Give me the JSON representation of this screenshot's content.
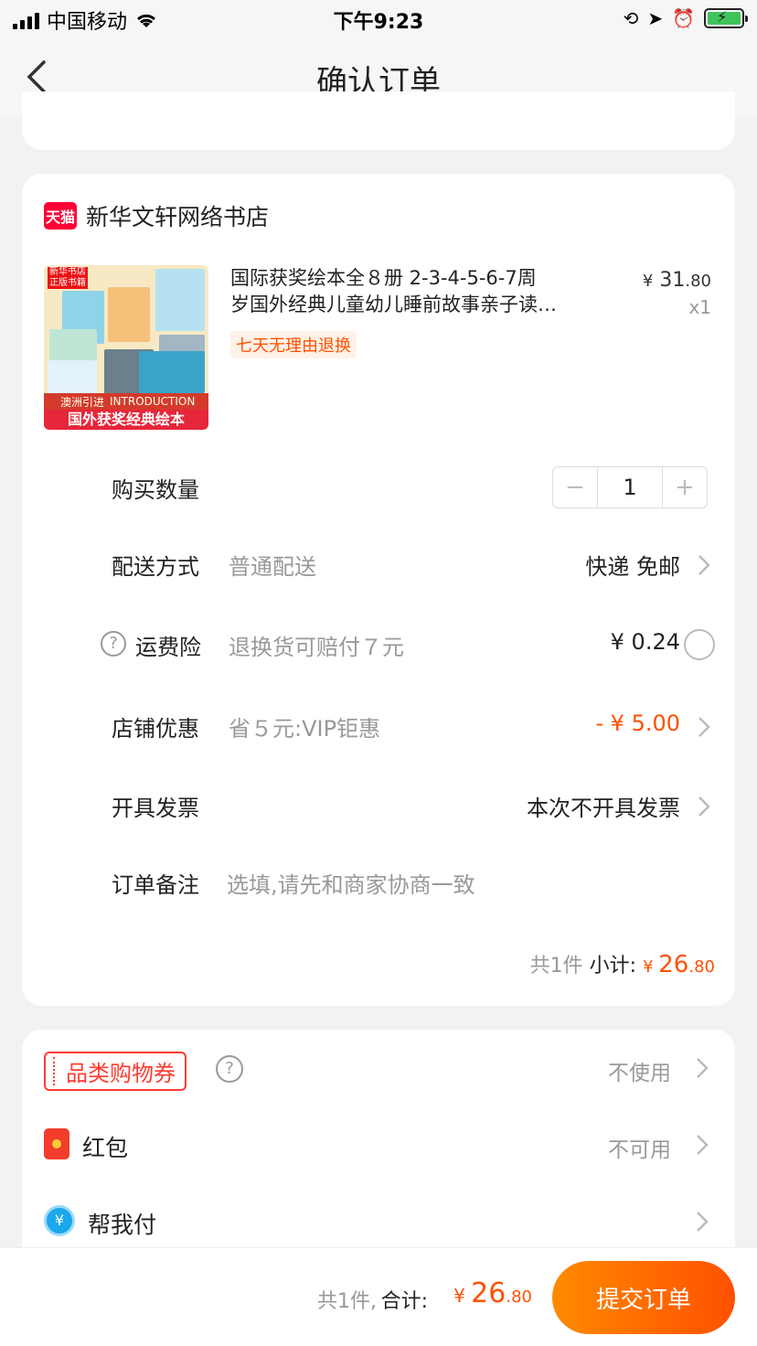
{
  "status_bar": {
    "carrier": "中国移动",
    "time": "下午9:23"
  },
  "nav": {
    "title": "确认订单"
  },
  "shop": {
    "badge": "天猫",
    "name": "新华文轩网络书店"
  },
  "product": {
    "title_line1": "国际获奖绘本全８册 2-3-4-5-6-7周",
    "title_line2": "岁国外经典儿童幼儿睡前故事亲子读…",
    "price_yen": "¥",
    "price_int": " 31",
    "price_dec": ".80",
    "qty": "x1",
    "return_badge": "七天无理由退换",
    "thumb_logo": "新华书店 正版书籍",
    "thumb_intro": "澳洲引进",
    "thumb_intro_en": "INTRODUCTION",
    "thumb_banner": "国外获奖经典绘本"
  },
  "rows": {
    "quantity_label": "购买数量",
    "quantity_value": "1",
    "minus": "−",
    "plus": "+",
    "delivery_label": "配送方式",
    "delivery_hint": "普通配送",
    "delivery_value": "快递 免邮",
    "insurance_label": "运费险",
    "insurance_hint": "退换货可赔付７元",
    "insurance_value": "¥ 0.24",
    "discount_label": "店铺优惠",
    "discount_hint": "省５元:VIP钜惠",
    "discount_value": "- ¥ 5.00",
    "invoice_label": "开具发票",
    "invoice_value": "本次不开具发票",
    "note_label": "订单备注",
    "note_placeholder": "选填,请先和商家协商一致"
  },
  "subtotal": {
    "count": "共1件",
    "label": "小计:",
    "yen": "¥ ",
    "int": "26",
    "dec": ".80"
  },
  "coupons": {
    "category_coupon": "品类购物券",
    "category_value": "不使用",
    "redpacket_label": "红包",
    "redpacket_value": "不可用",
    "helpay_label": "帮我付"
  },
  "bottom": {
    "count": "共1件,",
    "label": "合计:",
    "yen": "¥ ",
    "int": "26",
    "dec": ".80",
    "submit": "提交订单"
  },
  "colors": {
    "accent": "#ff5000",
    "tmall": "#ff0036"
  }
}
